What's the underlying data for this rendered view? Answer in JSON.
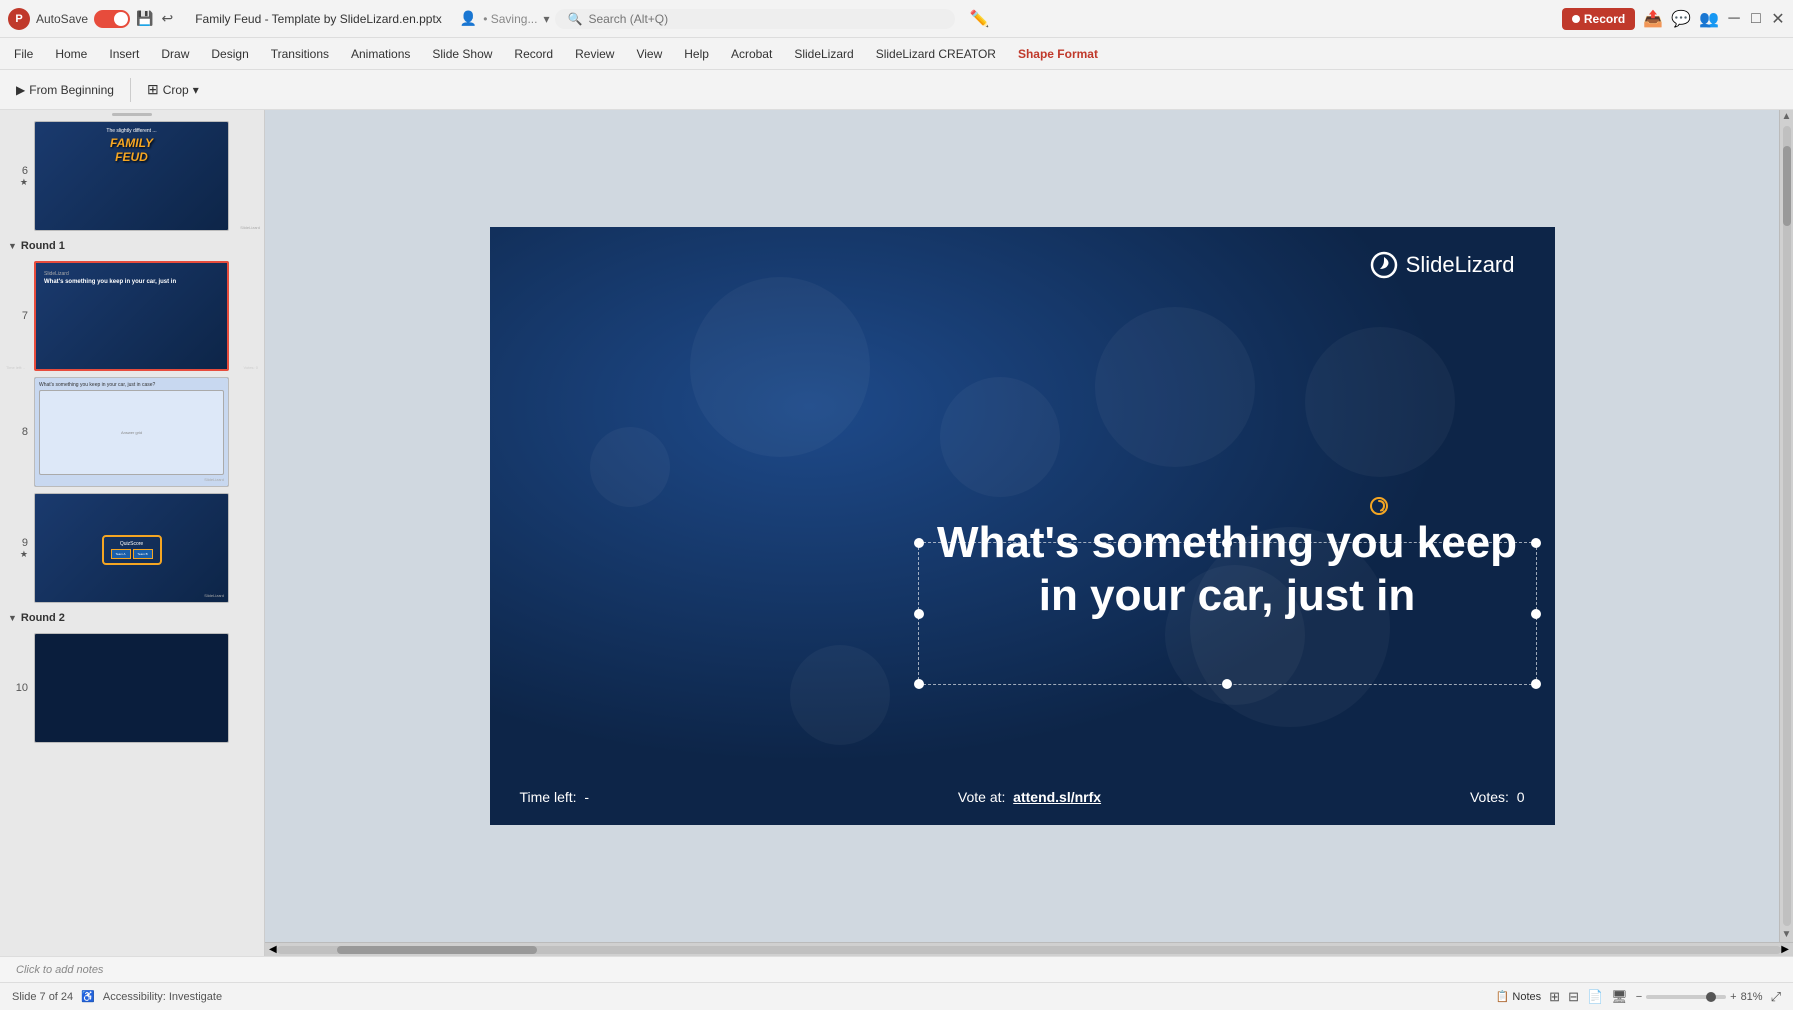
{
  "titlebar": {
    "autosave_label": "AutoSave",
    "filename": "Family Feud - Template by SlideLizard.en.pptx",
    "saving_text": "• Saving...",
    "search_placeholder": "Search (Alt+Q)",
    "record_label": "Record"
  },
  "menubar": {
    "items": [
      {
        "id": "file",
        "label": "File"
      },
      {
        "id": "home",
        "label": "Home"
      },
      {
        "id": "insert",
        "label": "Insert"
      },
      {
        "id": "draw",
        "label": "Draw"
      },
      {
        "id": "design",
        "label": "Design"
      },
      {
        "id": "transitions",
        "label": "Transitions"
      },
      {
        "id": "animations",
        "label": "Animations"
      },
      {
        "id": "slideshow",
        "label": "Slide Show"
      },
      {
        "id": "record",
        "label": "Record"
      },
      {
        "id": "review",
        "label": "Review"
      },
      {
        "id": "view",
        "label": "View"
      },
      {
        "id": "help",
        "label": "Help"
      },
      {
        "id": "acrobat",
        "label": "Acrobat"
      },
      {
        "id": "slidelizard",
        "label": "SlideLizard"
      },
      {
        "id": "slidelizard-creator",
        "label": "SlideLizard CREATOR"
      },
      {
        "id": "shape-format",
        "label": "Shape Format",
        "active": true
      }
    ]
  },
  "toolbar": {
    "from_beginning": "From Beginning",
    "crop": "Crop"
  },
  "sidebar": {
    "sections": [
      {
        "id": "round1",
        "label": "Round 1",
        "expanded": true,
        "slides": [
          {
            "number": "7",
            "star": false,
            "type": "question",
            "active": true,
            "text": "What's something you keep in your car, just in"
          },
          {
            "number": "8",
            "star": false,
            "type": "answers"
          }
        ]
      },
      {
        "id": "round2",
        "label": "Round 2",
        "expanded": false,
        "slides": [
          {
            "number": "10",
            "star": false,
            "type": "scoreboard"
          }
        ]
      }
    ],
    "earlier_slides": [
      {
        "number": "6",
        "star": true,
        "type": "family-feud"
      },
      {
        "number": "9",
        "star": true,
        "type": "scoreboard"
      }
    ]
  },
  "slide": {
    "logo_text_part1": "Slide",
    "logo_text_part2": "Lizard",
    "main_question": "What's something you keep in your car, just in",
    "time_left_label": "Time left:",
    "time_left_value": "-",
    "vote_label": "Vote at:",
    "vote_url": "attend.sl/nrfx",
    "votes_label": "Votes:",
    "votes_value": "0"
  },
  "statusbar": {
    "slide_info": "Slide 7 of 24",
    "accessibility": "Accessibility: Investigate",
    "notes_label": "Notes",
    "zoom_level": "81%",
    "click_to_add_notes": "Click to add notes"
  }
}
